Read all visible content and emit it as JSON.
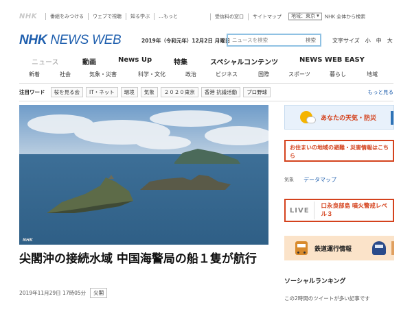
{
  "utility": {
    "logo": "NHK",
    "links": [
      "番組をみつける",
      "ウェブで視聴",
      "知る学ぶ",
      "…もっと"
    ],
    "reception": "受信料の窓口",
    "sitemap": "サイトマップ",
    "region_label": "地域：東京",
    "nhk_search": "NHK 全体から検索"
  },
  "header": {
    "brand_nhk": "NHK",
    "brand_rest": "NEWS WEB",
    "date": "2019年（令和元年）12月2日 月曜日",
    "search_placeholder": "ニュースを検索",
    "search_button": "検索",
    "font_size_label": "文字サイズ",
    "font_sizes": [
      "小",
      "中",
      "大"
    ]
  },
  "main_nav": [
    "ニュース",
    "動画",
    "News Up",
    "特集",
    "スペシャルコンテンツ",
    "NEWS WEB EASY"
  ],
  "sub_nav": [
    "新着",
    "社会",
    "気象・災害",
    "科学・文化",
    "政治",
    "ビジネス",
    "国際",
    "スポーツ",
    "暮らし",
    "地域"
  ],
  "keywords": {
    "label": "注目ワード",
    "tags": [
      "桜を見る会",
      "IT・ネット",
      "環境",
      "気象",
      "２０２０東京",
      "香港 抗議活動",
      "プロ野球"
    ],
    "more": "もっと見る"
  },
  "article": {
    "watermark": "NHK",
    "headline": "尖閣沖の接続水域 中国海警局の船１隻が航行",
    "datetime": "2019年11月29日 17時05分",
    "category": "尖閣"
  },
  "sidebar": {
    "weather": "あなたの天気・防災",
    "evacuation": "お住まいの地域の避難・災害情報はこちら",
    "datamap_key": "気象",
    "datamap_value": "データマップ",
    "live_label": "LIVE",
    "live_text": "口永良部島 噴火警戒レベル３",
    "train": "鉄道運行情報",
    "social_title": "ソーシャルランキング",
    "social_sub": "この2時間のツイートが多い記事です"
  },
  "colors": {
    "brand_blue": "#1f5fae",
    "alert_red": "#d4421d",
    "weather_bg": "#e8f1fb",
    "train_bg": "#fbe3c9"
  }
}
